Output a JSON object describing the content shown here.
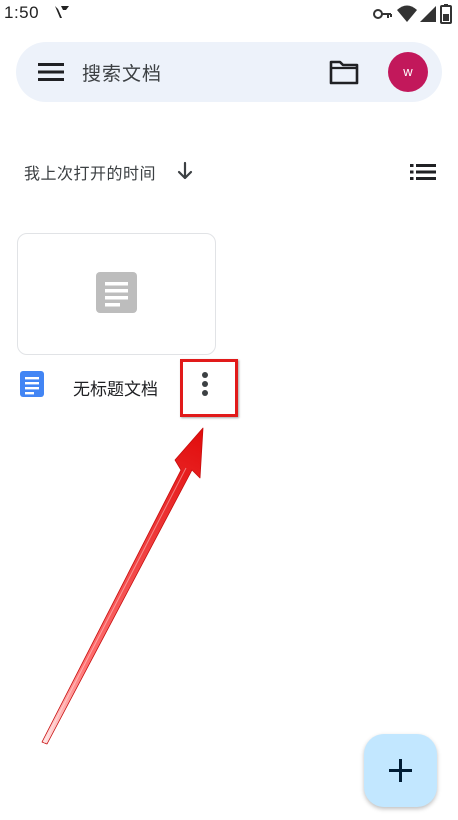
{
  "status_bar": {
    "time": "1:50",
    "icons": [
      "carrier-icon",
      "vpn-key-icon",
      "wifi-icon",
      "signal-icon",
      "battery-icon"
    ]
  },
  "search": {
    "placeholder": "搜索文档",
    "account_initial": "w"
  },
  "sort": {
    "label": "我上次打开的时间"
  },
  "documents": [
    {
      "title": "无标题文档",
      "type": "Google Docs"
    }
  ],
  "colors": {
    "search_bar_bg": "#edf2fa",
    "avatar_bg": "#c2185b",
    "doc_blue": "#4285f4",
    "preview_gray": "#bdbdbd",
    "fab_bg": "#c2e7ff",
    "annotation_red": "#e11a1a"
  }
}
